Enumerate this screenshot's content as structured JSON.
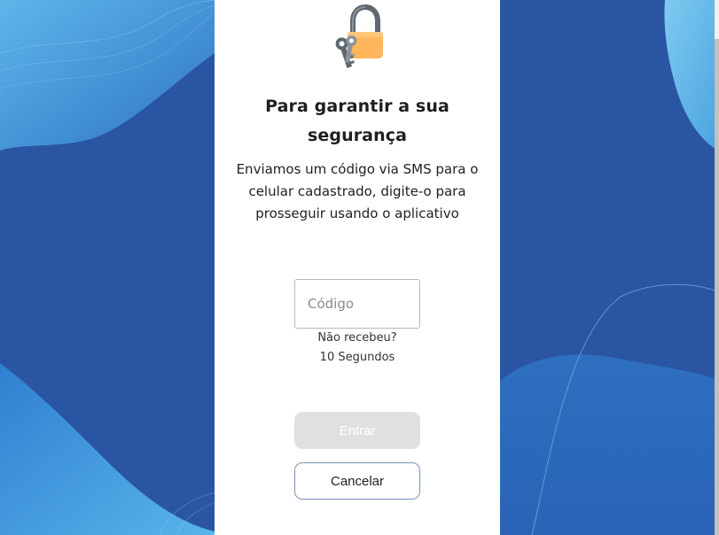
{
  "icon": {
    "lock": "lock-with-key-icon"
  },
  "title": "Para garantir a sua segurança",
  "subtitle": "Enviamos um código via SMS para o celular cadastrado, digite-o para prosseguir usando o aplicativo",
  "code_input": {
    "placeholder": "Código",
    "value": ""
  },
  "resend": {
    "label": "Não recebeu?",
    "countdown": "10 Segundos"
  },
  "buttons": {
    "enter": "Entrar",
    "enter_state": "disabled",
    "cancel": "Cancelar"
  },
  "colors": {
    "background": "#2a55a3",
    "light_wave": "#4aa0e0",
    "panel": "#ffffff",
    "disabled_button": "#e0e0e0"
  }
}
